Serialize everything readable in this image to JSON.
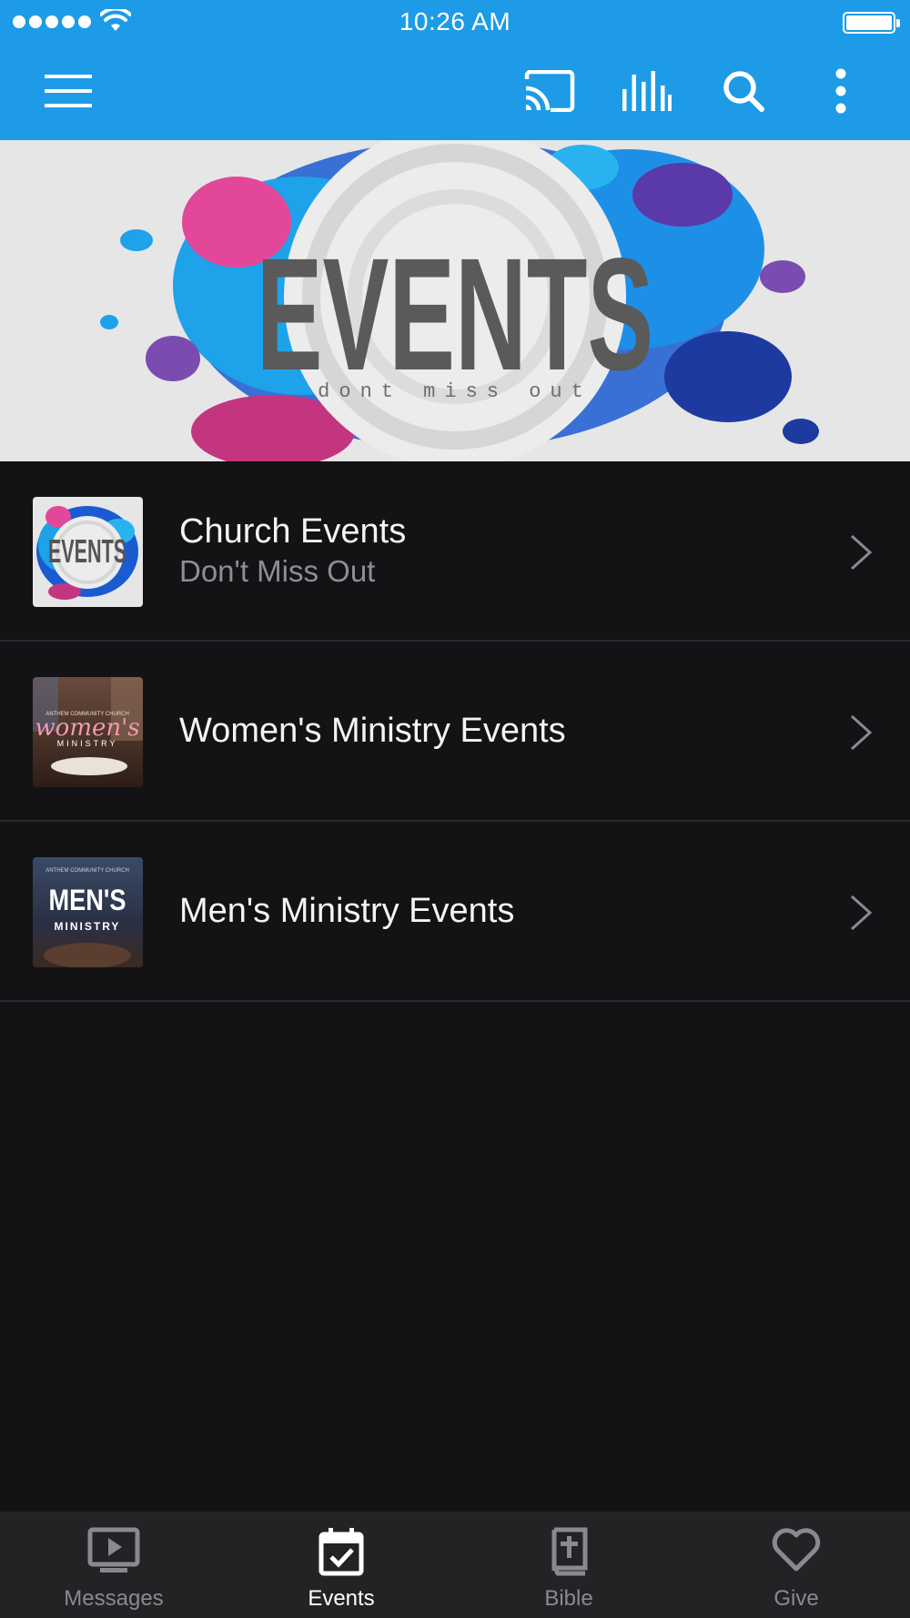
{
  "status_bar": {
    "time": "10:26 AM"
  },
  "toolbar": {
    "icons": [
      "menu-icon",
      "cast-icon",
      "equalizer-icon",
      "search-icon",
      "more-vert-icon"
    ]
  },
  "banner": {
    "title": "EVENTS",
    "subtitle": "dont miss out"
  },
  "list": {
    "items": [
      {
        "title": "Church Events",
        "subtitle": "Don't Miss Out",
        "thumb_title": "EVENTS"
      },
      {
        "title": "Women's Ministry Events",
        "thumb_line1": "ANTHEM COMMUNITY CHURCH",
        "thumb_line2": "women's",
        "thumb_line3": "MINISTRY"
      },
      {
        "title": "Men's Ministry Events",
        "thumb_line1": "ANTHEM COMMUNITY CHURCH",
        "thumb_line2": "MEN'S",
        "thumb_line3": "MINISTRY"
      }
    ]
  },
  "tabbar": {
    "tabs": [
      {
        "label": "Messages",
        "icon": "tv-play-icon",
        "active": false
      },
      {
        "label": "Events",
        "icon": "calendar-check-icon",
        "active": true
      },
      {
        "label": "Bible",
        "icon": "bible-icon",
        "active": false
      },
      {
        "label": "Give",
        "icon": "heart-icon",
        "active": false
      }
    ]
  },
  "colors": {
    "accent": "#1d9be6",
    "background": "#131315",
    "tabbar": "#232326",
    "secondary_text": "#8e8e93"
  }
}
